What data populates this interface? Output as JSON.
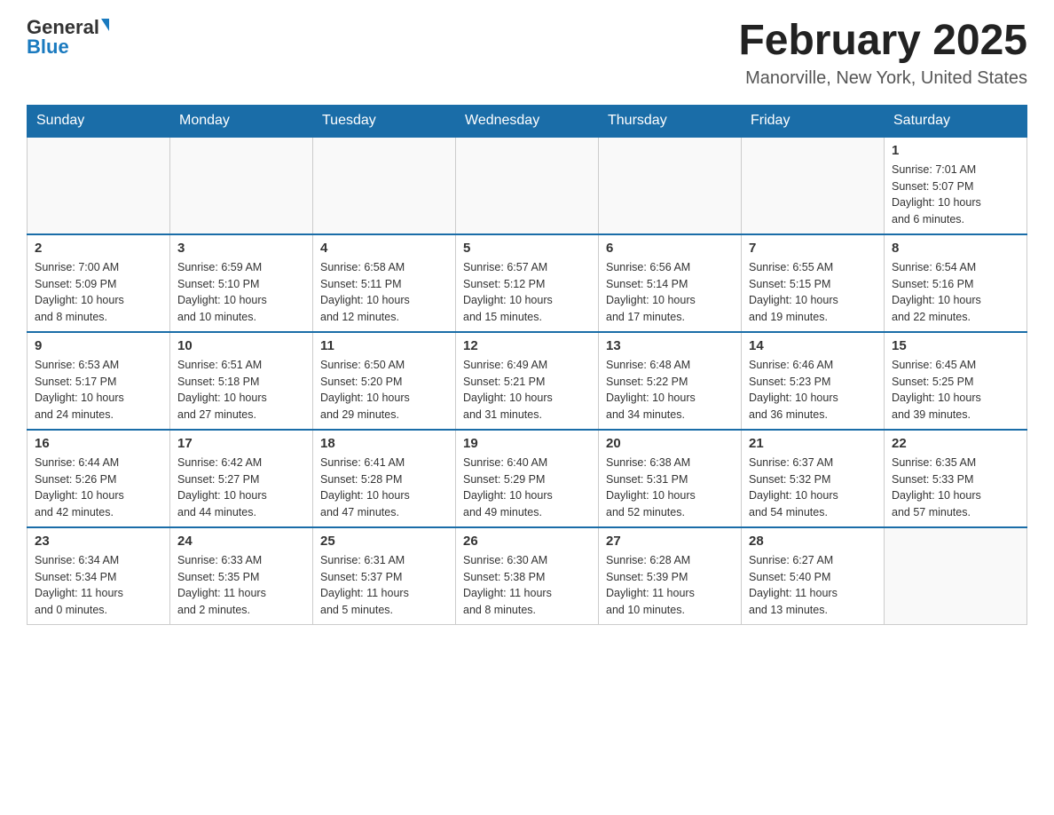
{
  "logo": {
    "general": "General",
    "blue": "Blue"
  },
  "title": "February 2025",
  "location": "Manorville, New York, United States",
  "weekdays": [
    "Sunday",
    "Monday",
    "Tuesday",
    "Wednesday",
    "Thursday",
    "Friday",
    "Saturday"
  ],
  "weeks": [
    [
      {
        "day": "",
        "info": ""
      },
      {
        "day": "",
        "info": ""
      },
      {
        "day": "",
        "info": ""
      },
      {
        "day": "",
        "info": ""
      },
      {
        "day": "",
        "info": ""
      },
      {
        "day": "",
        "info": ""
      },
      {
        "day": "1",
        "info": "Sunrise: 7:01 AM\nSunset: 5:07 PM\nDaylight: 10 hours\nand 6 minutes."
      }
    ],
    [
      {
        "day": "2",
        "info": "Sunrise: 7:00 AM\nSunset: 5:09 PM\nDaylight: 10 hours\nand 8 minutes."
      },
      {
        "day": "3",
        "info": "Sunrise: 6:59 AM\nSunset: 5:10 PM\nDaylight: 10 hours\nand 10 minutes."
      },
      {
        "day": "4",
        "info": "Sunrise: 6:58 AM\nSunset: 5:11 PM\nDaylight: 10 hours\nand 12 minutes."
      },
      {
        "day": "5",
        "info": "Sunrise: 6:57 AM\nSunset: 5:12 PM\nDaylight: 10 hours\nand 15 minutes."
      },
      {
        "day": "6",
        "info": "Sunrise: 6:56 AM\nSunset: 5:14 PM\nDaylight: 10 hours\nand 17 minutes."
      },
      {
        "day": "7",
        "info": "Sunrise: 6:55 AM\nSunset: 5:15 PM\nDaylight: 10 hours\nand 19 minutes."
      },
      {
        "day": "8",
        "info": "Sunrise: 6:54 AM\nSunset: 5:16 PM\nDaylight: 10 hours\nand 22 minutes."
      }
    ],
    [
      {
        "day": "9",
        "info": "Sunrise: 6:53 AM\nSunset: 5:17 PM\nDaylight: 10 hours\nand 24 minutes."
      },
      {
        "day": "10",
        "info": "Sunrise: 6:51 AM\nSunset: 5:18 PM\nDaylight: 10 hours\nand 27 minutes."
      },
      {
        "day": "11",
        "info": "Sunrise: 6:50 AM\nSunset: 5:20 PM\nDaylight: 10 hours\nand 29 minutes."
      },
      {
        "day": "12",
        "info": "Sunrise: 6:49 AM\nSunset: 5:21 PM\nDaylight: 10 hours\nand 31 minutes."
      },
      {
        "day": "13",
        "info": "Sunrise: 6:48 AM\nSunset: 5:22 PM\nDaylight: 10 hours\nand 34 minutes."
      },
      {
        "day": "14",
        "info": "Sunrise: 6:46 AM\nSunset: 5:23 PM\nDaylight: 10 hours\nand 36 minutes."
      },
      {
        "day": "15",
        "info": "Sunrise: 6:45 AM\nSunset: 5:25 PM\nDaylight: 10 hours\nand 39 minutes."
      }
    ],
    [
      {
        "day": "16",
        "info": "Sunrise: 6:44 AM\nSunset: 5:26 PM\nDaylight: 10 hours\nand 42 minutes."
      },
      {
        "day": "17",
        "info": "Sunrise: 6:42 AM\nSunset: 5:27 PM\nDaylight: 10 hours\nand 44 minutes."
      },
      {
        "day": "18",
        "info": "Sunrise: 6:41 AM\nSunset: 5:28 PM\nDaylight: 10 hours\nand 47 minutes."
      },
      {
        "day": "19",
        "info": "Sunrise: 6:40 AM\nSunset: 5:29 PM\nDaylight: 10 hours\nand 49 minutes."
      },
      {
        "day": "20",
        "info": "Sunrise: 6:38 AM\nSunset: 5:31 PM\nDaylight: 10 hours\nand 52 minutes."
      },
      {
        "day": "21",
        "info": "Sunrise: 6:37 AM\nSunset: 5:32 PM\nDaylight: 10 hours\nand 54 minutes."
      },
      {
        "day": "22",
        "info": "Sunrise: 6:35 AM\nSunset: 5:33 PM\nDaylight: 10 hours\nand 57 minutes."
      }
    ],
    [
      {
        "day": "23",
        "info": "Sunrise: 6:34 AM\nSunset: 5:34 PM\nDaylight: 11 hours\nand 0 minutes."
      },
      {
        "day": "24",
        "info": "Sunrise: 6:33 AM\nSunset: 5:35 PM\nDaylight: 11 hours\nand 2 minutes."
      },
      {
        "day": "25",
        "info": "Sunrise: 6:31 AM\nSunset: 5:37 PM\nDaylight: 11 hours\nand 5 minutes."
      },
      {
        "day": "26",
        "info": "Sunrise: 6:30 AM\nSunset: 5:38 PM\nDaylight: 11 hours\nand 8 minutes."
      },
      {
        "day": "27",
        "info": "Sunrise: 6:28 AM\nSunset: 5:39 PM\nDaylight: 11 hours\nand 10 minutes."
      },
      {
        "day": "28",
        "info": "Sunrise: 6:27 AM\nSunset: 5:40 PM\nDaylight: 11 hours\nand 13 minutes."
      },
      {
        "day": "",
        "info": ""
      }
    ]
  ]
}
